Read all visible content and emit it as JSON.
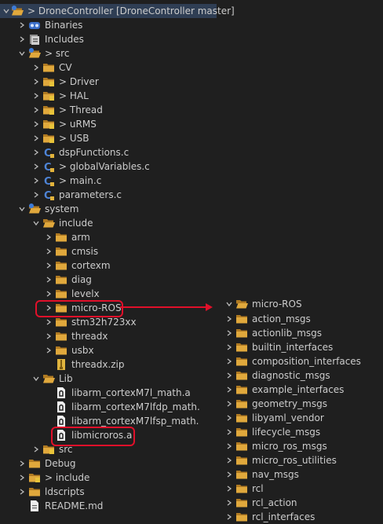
{
  "left_tree": {
    "project": {
      "prefix": ">",
      "label": "DroneController [DroneController master]"
    },
    "binaries": "Binaries",
    "includes": "Includes",
    "src": {
      "prefix": ">",
      "label": "src"
    },
    "cv": "CV",
    "driver": {
      "prefix": ">",
      "label": "Driver"
    },
    "hal": {
      "prefix": ">",
      "label": "HAL"
    },
    "thread": {
      "prefix": ">",
      "label": "Thread"
    },
    "urms": {
      "prefix": ">",
      "label": "uRMS"
    },
    "usb": {
      "prefix": ">",
      "label": "USB"
    },
    "dsp": "dspFunctions.c",
    "globals": {
      "prefix": ">",
      "label": "globalVariables.c"
    },
    "main": {
      "prefix": ">",
      "label": "main.c"
    },
    "params": "parameters.c",
    "system": "system",
    "include": "include",
    "arm": "arm",
    "cmsis": "cmsis",
    "cortexm": "cortexm",
    "diag": "diag",
    "levelx": "levelx",
    "microros": "micro-ROS",
    "stm32": "stm32h723xx",
    "threadx": "threadx",
    "usbx": "usbx",
    "threadxzip": "threadx.zip",
    "lib": "Lib",
    "lib1": "libarm_cortexM7l_math.a",
    "lib2": "libarm_cortexM7lfdp_math.",
    "lib3": "libarm_cortexM7lfsp_math.",
    "lib4": "libmicroros.a",
    "src2": "src",
    "debug": "Debug",
    "include2": {
      "prefix": ">",
      "label": "include"
    },
    "ldscripts": "ldscripts",
    "readme": "README.md"
  },
  "right_tree": {
    "root": "micro-ROS",
    "items": [
      "action_msgs",
      "actionlib_msgs",
      "builtin_interfaces",
      "composition_interfaces",
      "diagnostic_msgs",
      "example_interfaces",
      "geometry_msgs",
      "libyaml_vendor",
      "lifecycle_msgs",
      "micro_ros_msgs",
      "micro_ros_utilities",
      "nav_msgs",
      "rcl",
      "rcl_action",
      "rcl_interfaces"
    ]
  },
  "colors": {
    "background": "#1f1f1f",
    "selection": "#2f3e54",
    "callout": "#e0102a",
    "folder": "#d9a23a"
  }
}
